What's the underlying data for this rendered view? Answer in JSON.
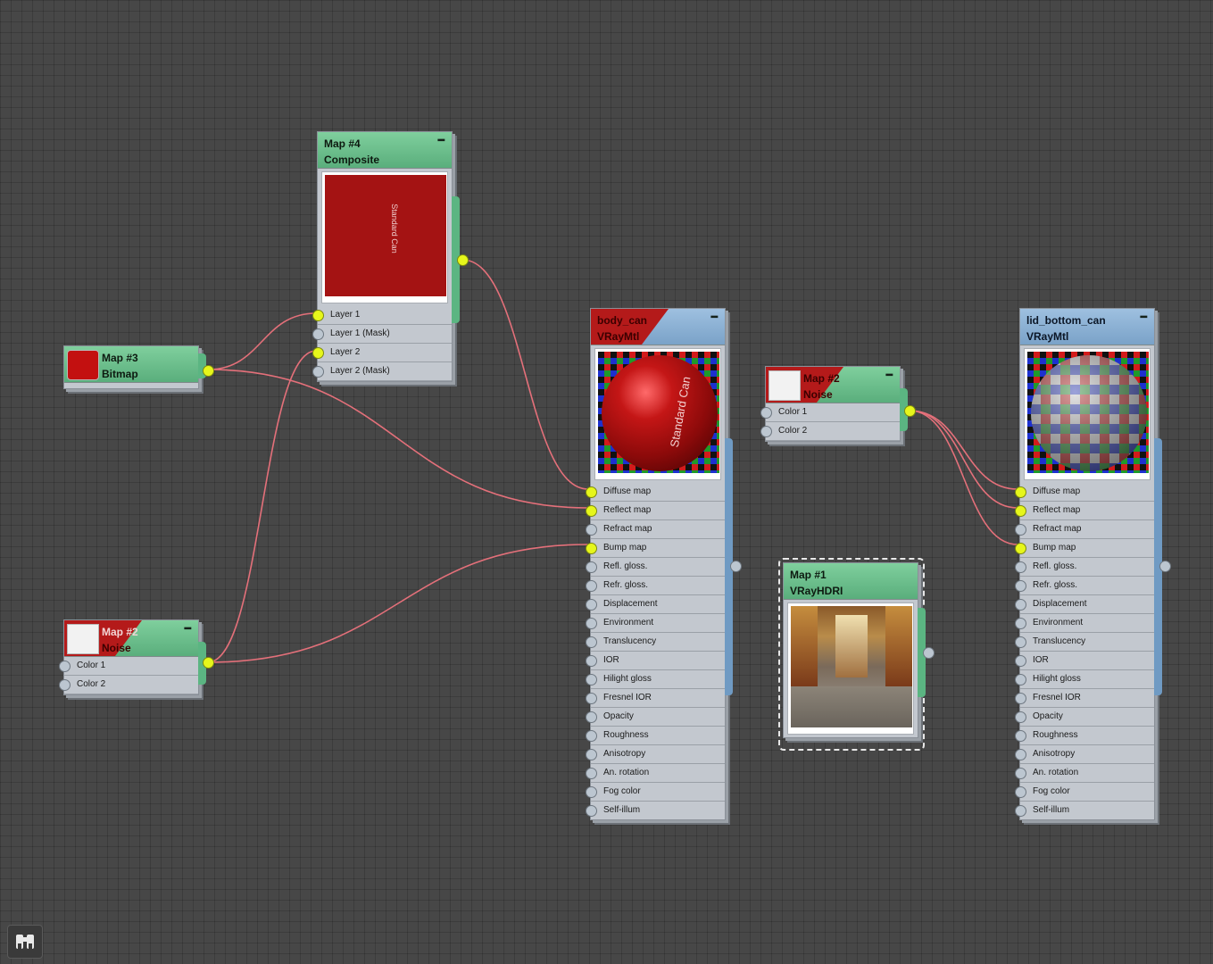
{
  "nodes": {
    "map4": {
      "name": "Map #4",
      "type": "Composite",
      "slots": [
        {
          "label": "Layer 1",
          "connected": true
        },
        {
          "label": "Layer 1 (Mask)",
          "connected": false
        },
        {
          "label": "Layer 2",
          "connected": true
        },
        {
          "label": "Layer 2 (Mask)",
          "connected": false
        }
      ],
      "preview_text": "Standard Can"
    },
    "map3": {
      "name": "Map #3",
      "type": "Bitmap"
    },
    "map2a": {
      "name": "Map #2",
      "type": "Noise",
      "slots": [
        {
          "label": "Color 1",
          "connected": false
        },
        {
          "label": "Color 2",
          "connected": false
        }
      ]
    },
    "body_can": {
      "name": "body_can",
      "type": "VRayMtl",
      "preview_text": "Standard Can",
      "slots": [
        {
          "label": "Diffuse map",
          "connected": true
        },
        {
          "label": "Reflect map",
          "connected": true
        },
        {
          "label": "Refract map",
          "connected": false
        },
        {
          "label": "Bump map",
          "connected": true
        },
        {
          "label": "Refl. gloss.",
          "connected": false
        },
        {
          "label": "Refr. gloss.",
          "connected": false
        },
        {
          "label": "Displacement",
          "connected": false
        },
        {
          "label": "Environment",
          "connected": false
        },
        {
          "label": "Translucency",
          "connected": false
        },
        {
          "label": "IOR",
          "connected": false
        },
        {
          "label": "Hilight gloss",
          "connected": false
        },
        {
          "label": "Fresnel IOR",
          "connected": false
        },
        {
          "label": "Opacity",
          "connected": false
        },
        {
          "label": "Roughness",
          "connected": false
        },
        {
          "label": "Anisotropy",
          "connected": false
        },
        {
          "label": "An. rotation",
          "connected": false
        },
        {
          "label": "Fog color",
          "connected": false
        },
        {
          "label": "Self-illum",
          "connected": false
        }
      ]
    },
    "map2b": {
      "name": "Map #2",
      "type": "Noise",
      "slots": [
        {
          "label": "Color 1",
          "connected": false
        },
        {
          "label": "Color 2",
          "connected": false
        }
      ]
    },
    "map1": {
      "name": "Map #1",
      "type": "VRayHDRI"
    },
    "lid_bottom_can": {
      "name": "lid_bottom_can",
      "type": "VRayMtl",
      "slots": [
        {
          "label": "Diffuse map",
          "connected": true
        },
        {
          "label": "Reflect map",
          "connected": true
        },
        {
          "label": "Refract map",
          "connected": false
        },
        {
          "label": "Bump map",
          "connected": true
        },
        {
          "label": "Refl. gloss.",
          "connected": false
        },
        {
          "label": "Refr. gloss.",
          "connected": false
        },
        {
          "label": "Displacement",
          "connected": false
        },
        {
          "label": "Environment",
          "connected": false
        },
        {
          "label": "Translucency",
          "connected": false
        },
        {
          "label": "IOR",
          "connected": false
        },
        {
          "label": "Hilight gloss",
          "connected": false
        },
        {
          "label": "Fresnel IOR",
          "connected": false
        },
        {
          "label": "Opacity",
          "connected": false
        },
        {
          "label": "Roughness",
          "connected": false
        },
        {
          "label": "Anisotropy",
          "connected": false
        },
        {
          "label": "An. rotation",
          "connected": false
        },
        {
          "label": "Fog color",
          "connected": false
        },
        {
          "label": "Self-illum",
          "connected": false
        }
      ]
    }
  },
  "colors": {
    "map_header": "#6bbf8c",
    "material_header": "#8db3d8",
    "wire": "#e4707a",
    "socket_connected": "#e6f61b"
  },
  "icons": {
    "collapse": "minus-icon",
    "corner": "binoculars-icon"
  }
}
